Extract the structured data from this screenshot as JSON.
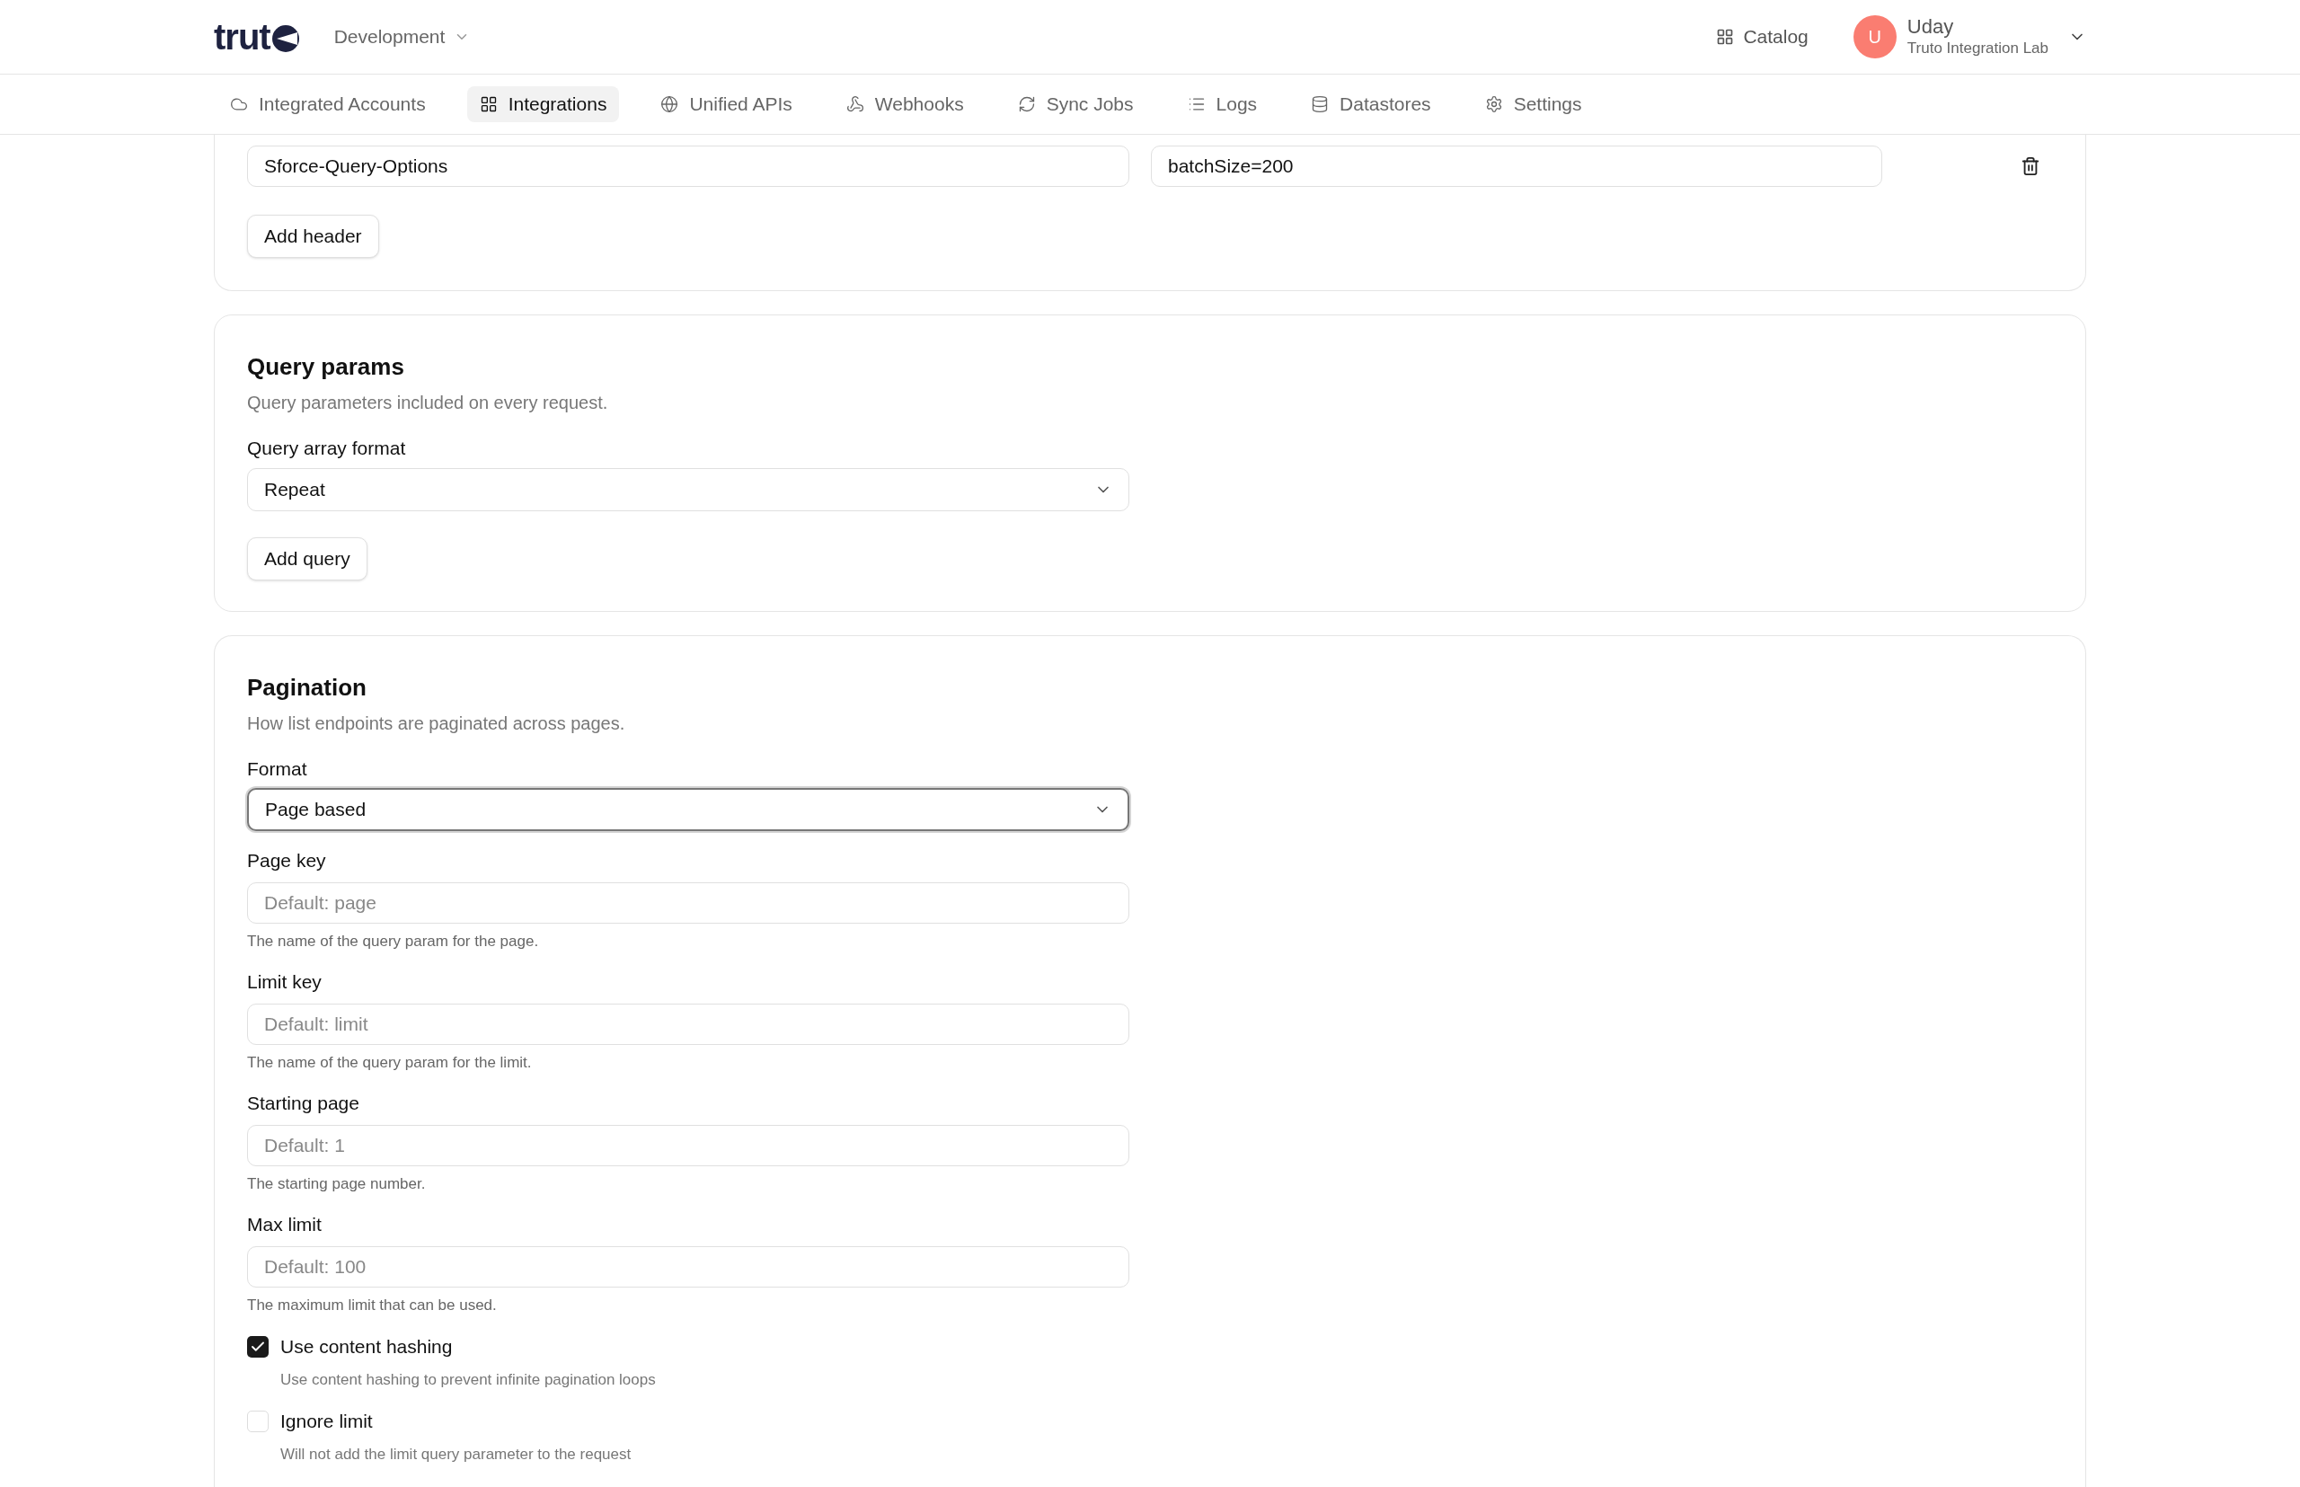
{
  "header": {
    "logo_text": "trut",
    "environment": "Development",
    "catalog": "Catalog",
    "user": {
      "initial": "U",
      "name": "Uday",
      "org": "Truto Integration Lab"
    }
  },
  "nav": [
    {
      "label": "Integrated Accounts",
      "kind": "cloud",
      "selected": false
    },
    {
      "label": "Integrations",
      "kind": "grid",
      "selected": true
    },
    {
      "label": "Unified APIs",
      "kind": "globe",
      "selected": false
    },
    {
      "label": "Webhooks",
      "kind": "webhook",
      "selected": false
    },
    {
      "label": "Sync Jobs",
      "kind": "sync",
      "selected": false
    },
    {
      "label": "Logs",
      "kind": "list",
      "selected": false
    },
    {
      "label": "Datastores",
      "kind": "database",
      "selected": false
    },
    {
      "label": "Settings",
      "kind": "gear",
      "selected": false
    }
  ],
  "headers_section": {
    "rows": [
      {
        "key": "Sforce-Query-Options",
        "value": "batchSize=200"
      }
    ],
    "add_button": "Add header"
  },
  "query_params": {
    "title": "Query params",
    "description": "Query parameters included on every request.",
    "array_format": {
      "label": "Query array format",
      "value": "Repeat"
    },
    "add_button": "Add query"
  },
  "pagination": {
    "title": "Pagination",
    "description": "How list endpoints are paginated across pages.",
    "format": {
      "label": "Format",
      "value": "Page based",
      "focused": true
    },
    "fields": [
      {
        "label": "Page key",
        "placeholder": "Default: page",
        "hint": "The name of the query param for the page."
      },
      {
        "label": "Limit key",
        "placeholder": "Default: limit",
        "hint": "The name of the query param for the limit."
      },
      {
        "label": "Starting page",
        "placeholder": "Default: 1",
        "hint": "The starting page number."
      },
      {
        "label": "Max limit",
        "placeholder": "Default: 100",
        "hint": "The maximum limit that can be used."
      }
    ],
    "checkboxes": [
      {
        "label": "Use content hashing",
        "hint": "Use content hashing to prevent infinite pagination loops",
        "checked": true
      },
      {
        "label": "Ignore limit",
        "hint": "Will not add the limit query parameter to the request",
        "checked": false
      }
    ]
  }
}
